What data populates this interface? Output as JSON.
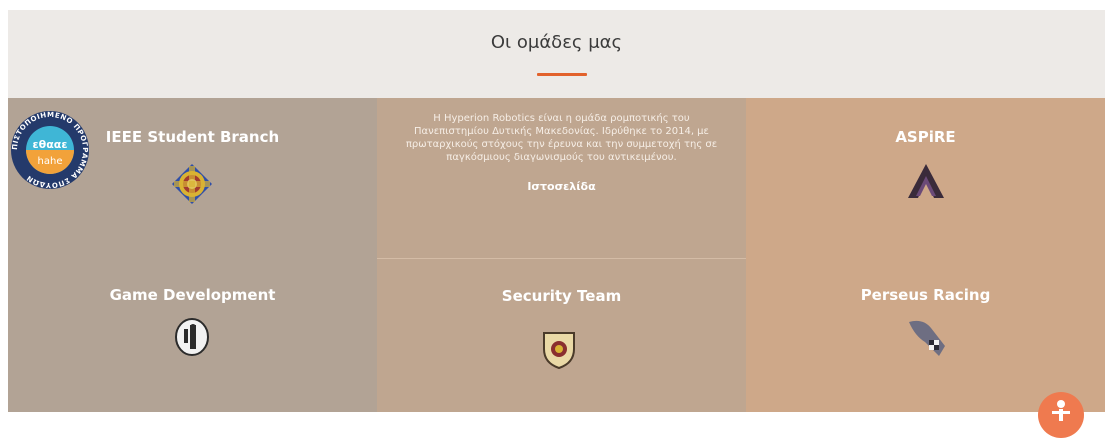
{
  "section": {
    "title": "Οι ομάδες μας",
    "accent_color": "#e2622c"
  },
  "teams": [
    {
      "name": "IEEE Student Branch",
      "icon": "ieee-branch-logo-icon"
    },
    {
      "description": "Η Hyperion Robotics είναι η ομάδα ρομποτικής του Πανεπιστημίου Δυτικής Μακεδονίας. Ιδρύθηκε το 2014, με πρωταρχικούς στόχους την έρευνα και την συμμετοχή της σε παγκόσμιους διαγωνισμούς του αντικειμένου.",
      "link_label": "Ιστοσελίδα"
    },
    {
      "name": "ASPiRE",
      "icon": "aspire-logo-icon"
    },
    {
      "name": "Game Development",
      "icon": "game-dev-logo-icon"
    },
    {
      "name": "Security Team",
      "icon": "security-shield-icon"
    },
    {
      "name": "Perseus Racing",
      "icon": "perseus-racing-logo-icon"
    }
  ],
  "badge": {
    "outer_text": "ΠΙΣΤΟΠΟΙΗΜΕΝΟ ΠΡΟΓΡΑΜΜΑ ΣΠΟΥΔΩΝ",
    "line1": "εθααε",
    "line2": "hahe"
  },
  "colors": {
    "grey": "#b2a395",
    "mid": "#bfa690",
    "peach": "#cea889"
  },
  "accessibility_button": {
    "icon": "accessibility-icon"
  }
}
